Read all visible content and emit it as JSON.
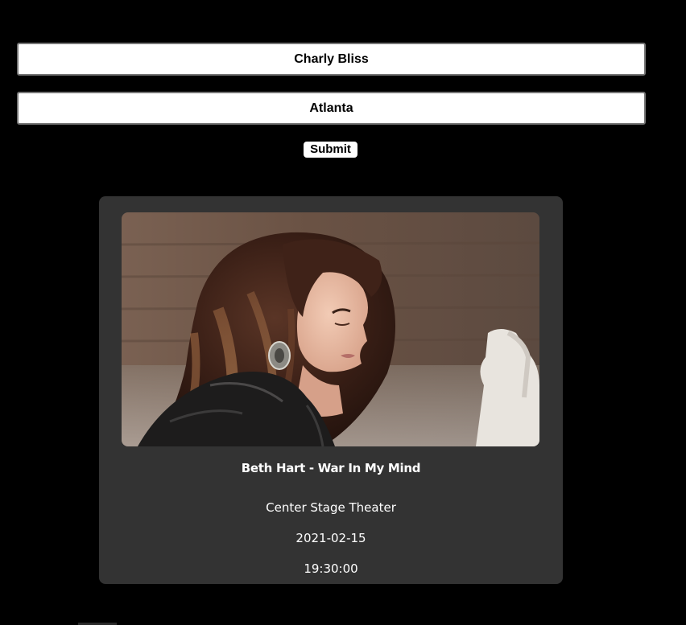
{
  "search": {
    "artist_value": "Charly Bliss",
    "city_value": "Atlanta",
    "submit_label": "Submit"
  },
  "event": {
    "title": "Beth Hart - War In My Mind",
    "venue": "Center Stage Theater",
    "date": "2021-02-15",
    "time": "19:30:00"
  },
  "colors": {
    "page_background": "#000000",
    "card_background": "#333333",
    "text": "#ffffff"
  }
}
